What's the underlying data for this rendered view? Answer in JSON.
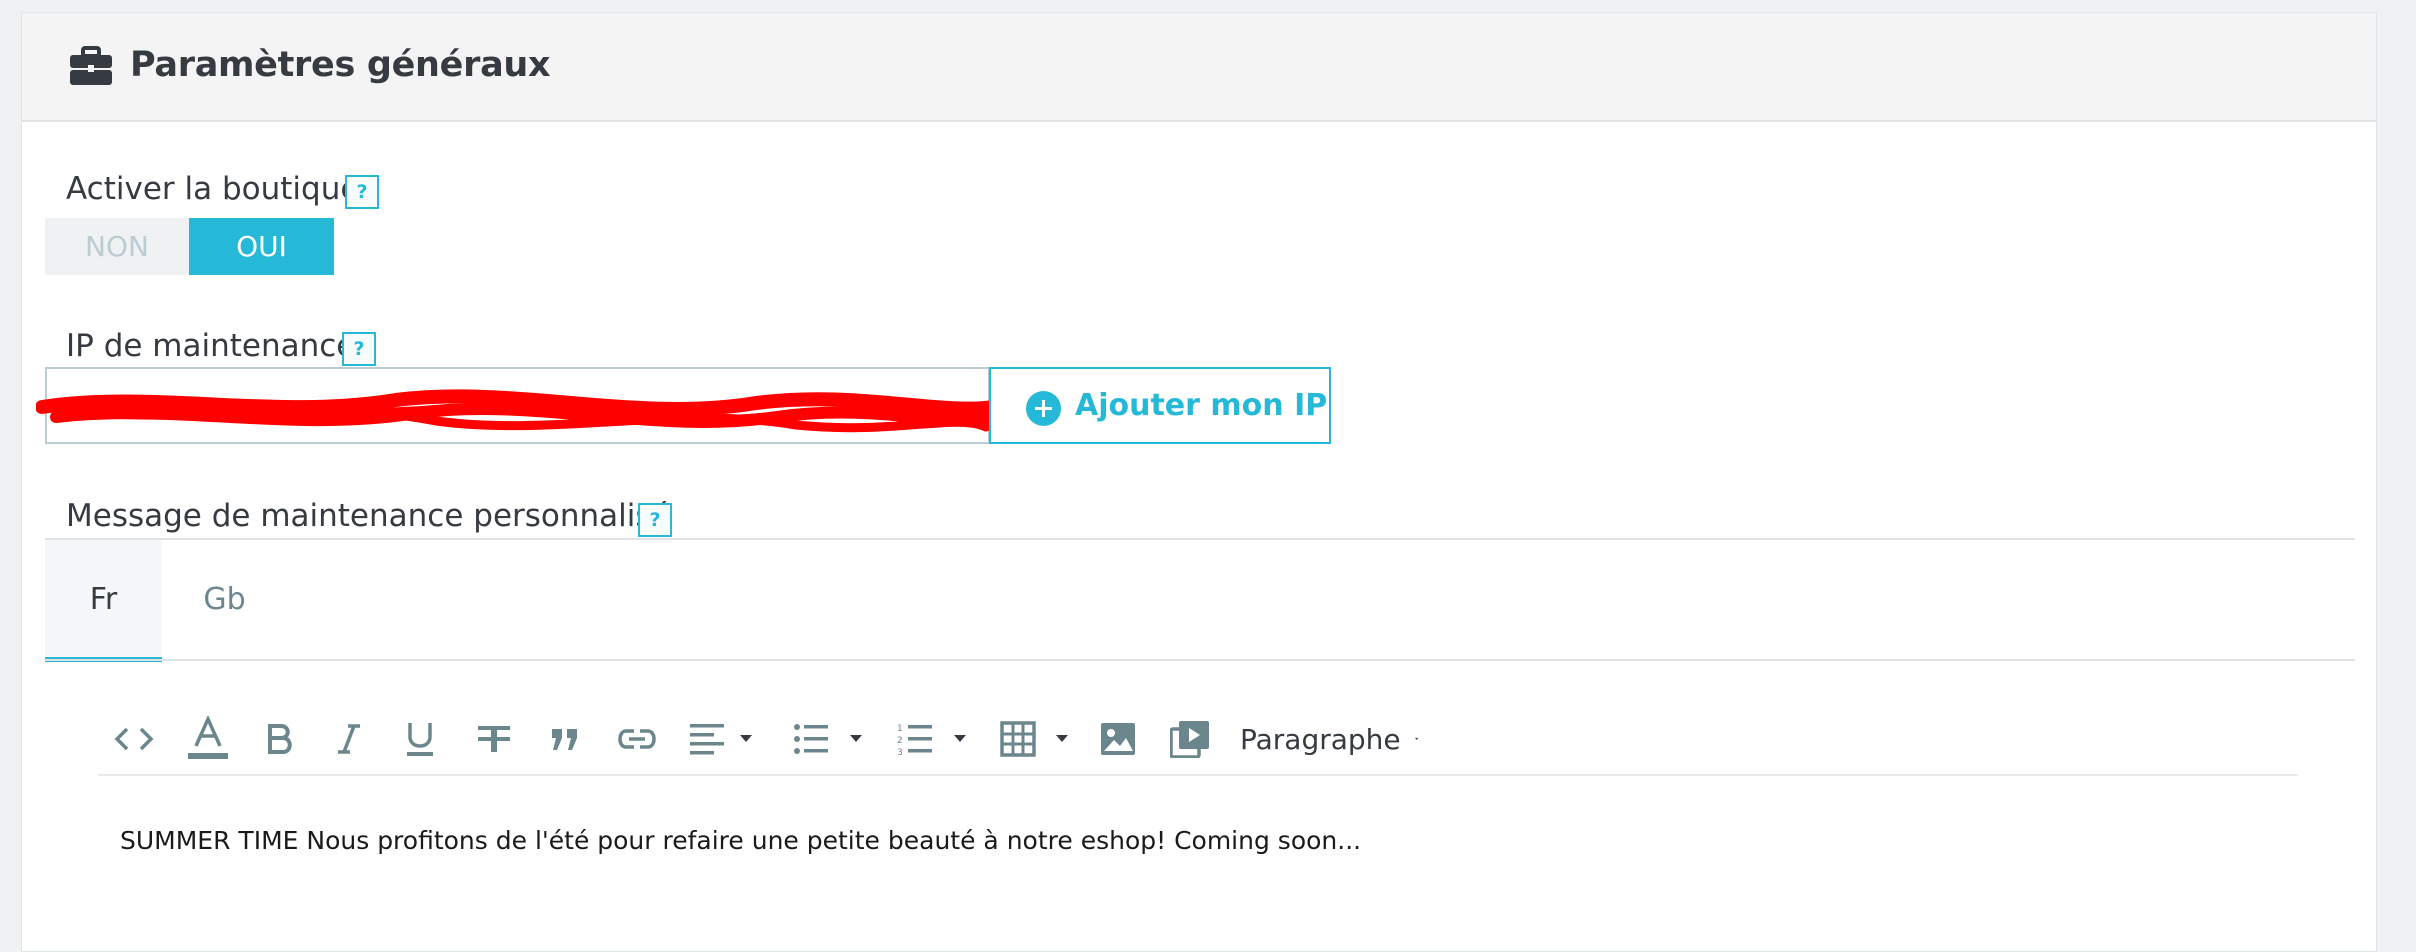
{
  "panel": {
    "title": "Paramètres généraux",
    "icon": "briefcase-icon"
  },
  "shop_active": {
    "label": "Activer la boutique",
    "help": "?",
    "off_label": "NON",
    "on_label": "OUI",
    "selected": "OUI"
  },
  "maintenance_ip": {
    "label": "IP de maintenance",
    "help": "?",
    "value": "",
    "redacted": true,
    "add_button": "Ajouter mon IP"
  },
  "maintenance_message": {
    "label": "Message de maintenance personnalisé",
    "help": "?",
    "tabs": [
      "Fr",
      "Gb"
    ],
    "active_tab": "Fr",
    "toolbar": {
      "icons": [
        "code-icon",
        "text-color-icon",
        "bold-icon",
        "italic-icon",
        "underline-icon",
        "strikethrough-icon",
        "blockquote-icon",
        "link-icon",
        "align-icon",
        "bullet-list-icon",
        "numbered-list-icon",
        "table-icon",
        "image-icon",
        "media-icon"
      ],
      "format_select": "Paragraphe"
    },
    "content": "SUMMER TIME Nous profitons de l'été pour refaire une petite beauté à notre eshop! Coming soon..."
  },
  "colors": {
    "accent": "#25b9d7",
    "text": "#363a41",
    "muted": "#bbcdd2",
    "redaction": "#ff0000"
  }
}
